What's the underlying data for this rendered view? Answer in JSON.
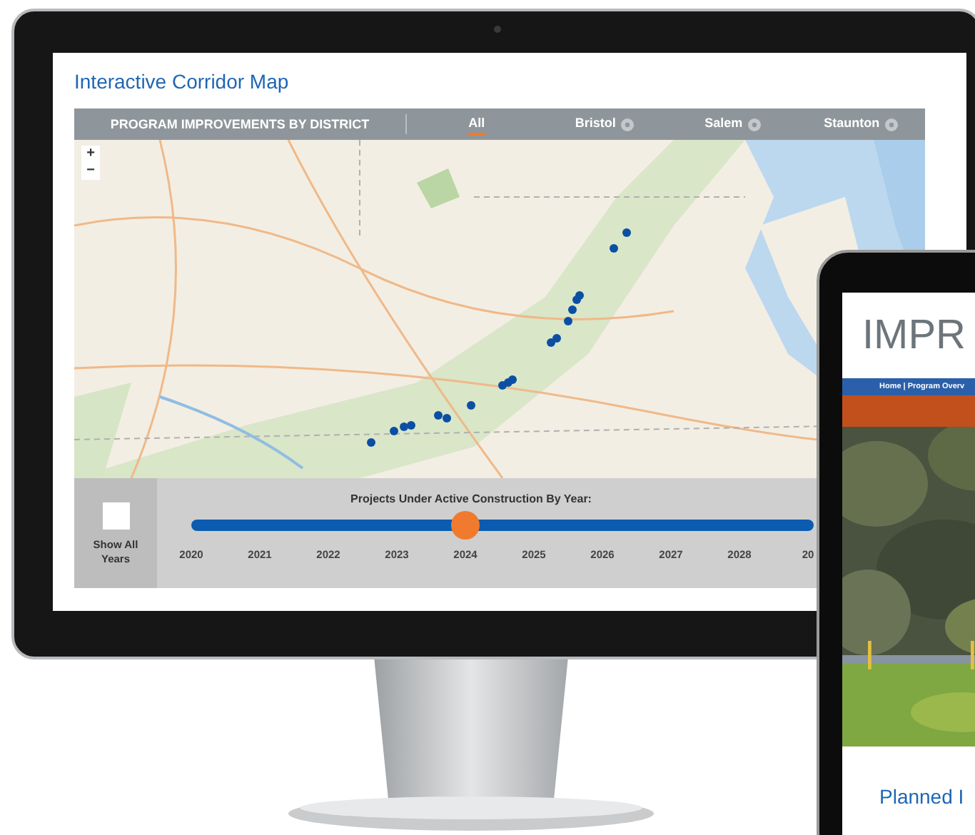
{
  "monitor": {
    "title": "Interactive Corridor Map",
    "district_bar": {
      "label": "PROGRAM IMPROVEMENTS BY DISTRICT",
      "tabs": [
        {
          "label": "All",
          "selected": true,
          "help": false
        },
        {
          "label": "Bristol",
          "selected": false,
          "help": true
        },
        {
          "label": "Salem",
          "selected": false,
          "help": true
        },
        {
          "label": "Staunton",
          "selected": false,
          "help": true
        }
      ]
    },
    "map": {
      "zoom_in": "+",
      "zoom_out": "−"
    },
    "timeline": {
      "show_all": {
        "label": "Show All Years",
        "checked": false
      },
      "title": "Projects Under Active Construction By Year:",
      "level": 0.44,
      "years": [
        "2020",
        "2021",
        "2022",
        "2023",
        "2024",
        "2025",
        "2026",
        "2027",
        "2028",
        "20"
      ]
    }
  },
  "tablet": {
    "title": "IMPR",
    "nav": "Home | Program Overv",
    "heading": "Planned I"
  }
}
